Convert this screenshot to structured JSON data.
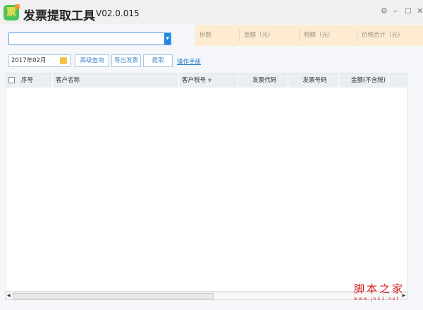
{
  "app": {
    "logo_char": "票",
    "title": "发票提取工具",
    "version": "V02.0.015"
  },
  "window_controls": {
    "settings": "⚙",
    "minimize": "–",
    "maximize": "☐",
    "close": "✕"
  },
  "summary": {
    "items": [
      "份数",
      "金额（元）",
      "税额（元）",
      "价税合计（元）"
    ]
  },
  "toolbar": {
    "date_value": "2017年02月",
    "advanced_query": "高级查询",
    "export": "导出发票",
    "extract": "提取",
    "manual": "操作手册"
  },
  "table": {
    "columns": [
      "序号",
      "客户名称",
      "客户税号",
      "发票代码",
      "发票号码",
      "金额(不含税)"
    ],
    "sort_icon": "▼"
  },
  "watermark": {
    "text": "脚本之家",
    "url": "www.jb51.net"
  }
}
